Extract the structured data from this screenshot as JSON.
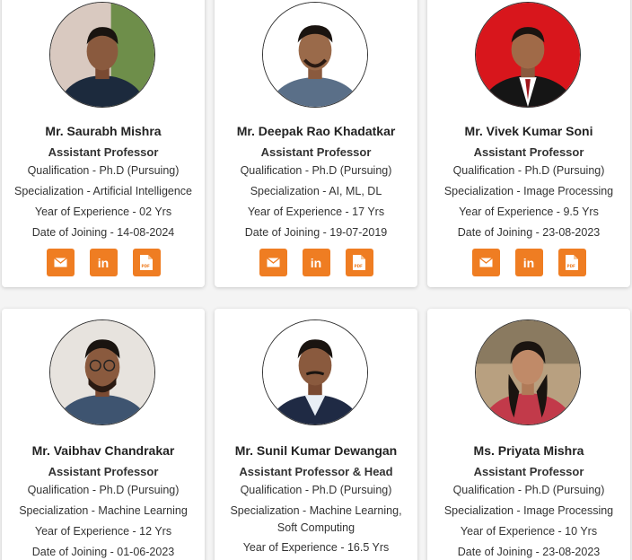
{
  "colors": {
    "accent": "#ef7d22",
    "card_bg": "#ffffff",
    "page_bg": "#f4f4f4"
  },
  "icons": {
    "email": "envelope-icon",
    "linkedin": "linkedin-icon",
    "pdf": "pdf-icon"
  },
  "linkedin_text": "in",
  "pdf_text": "PDF",
  "faculty": [
    {
      "name": "Mr. Saurabh Mishra",
      "designation": "Assistant Professor",
      "qualification": "Qualification - Ph.D (Pursuing)",
      "specialization": "Specialization - Artificial Intelligence",
      "experience": "Year of Experience - 02 Yrs",
      "joining": "Date of Joining - 14-08-2024"
    },
    {
      "name": "Mr. Deepak Rao Khadatkar",
      "designation": "Assistant Professor",
      "qualification": "Qualification - Ph.D (Pursuing)",
      "specialization": "Specialization - AI, ML, DL",
      "experience": "Year of Experience - 17 Yrs",
      "joining": "Date of Joining - 19-07-2019"
    },
    {
      "name": "Mr. Vivek Kumar Soni",
      "designation": "Assistant Professor",
      "qualification": "Qualification - Ph.D (Pursuing)",
      "specialization": "Specialization - Image Processing",
      "experience": "Year of Experience - 9.5 Yrs",
      "joining": "Date of Joining - 23-08-2023"
    },
    {
      "name": "Mr. Vaibhav Chandrakar",
      "designation": "Assistant Professor",
      "qualification": "Qualification - Ph.D (Pursuing)",
      "specialization": "Specialization - Machine Learning",
      "experience": "Year of Experience - 12 Yrs",
      "joining": "Date of Joining - 01-06-2023"
    },
    {
      "name": "Mr. Sunil Kumar Dewangan",
      "designation": "Assistant Professor & Head",
      "qualification": "Qualification - Ph.D (Pursuing)",
      "specialization_line1": "Specialization - Machine Learning,",
      "specialization_line2": "Soft Computing",
      "experience": "Year of Experience - 16.5 Yrs"
    },
    {
      "name": "Ms. Priyata Mishra",
      "designation": "Assistant Professor",
      "qualification": "Qualification - Ph.D (Pursuing)",
      "specialization": "Specialization - Image Processing",
      "experience": "Year of Experience - 10 Yrs",
      "joining": "Date of Joining - 23-08-2023"
    }
  ]
}
